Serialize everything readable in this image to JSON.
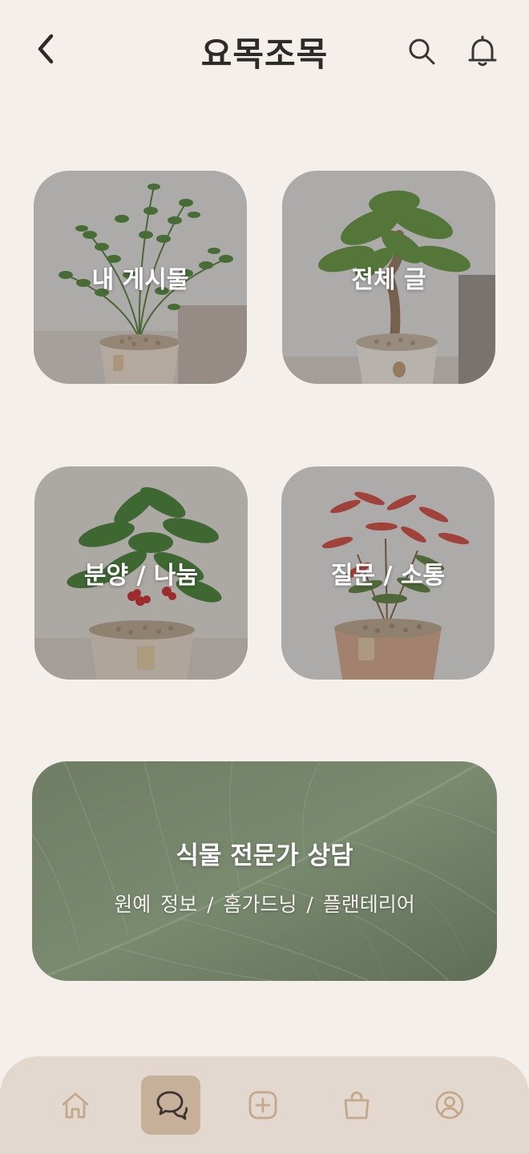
{
  "header": {
    "title": "요목조목",
    "back_icon": "chevron-left-icon",
    "search_icon": "search-icon",
    "notification_icon": "bell-icon"
  },
  "categories": [
    {
      "label": "내 게시물"
    },
    {
      "label": "전체 글"
    },
    {
      "label": "분양 / 나눔"
    },
    {
      "label": "질문 / 소통"
    }
  ],
  "consult_banner": {
    "title": "식물 전문가 상담",
    "subtitle": "원예 정보  /  홈가드닝  /  플랜테리어"
  },
  "bottom_nav": {
    "items": [
      {
        "icon": "home-icon",
        "active": false
      },
      {
        "icon": "chat-bubbles-icon",
        "active": true
      },
      {
        "icon": "add-square-icon",
        "active": false
      },
      {
        "icon": "shopping-bag-icon",
        "active": false
      },
      {
        "icon": "profile-icon",
        "active": false
      }
    ],
    "active_color": "#c6b09a",
    "icon_color": "#c4a889"
  },
  "colors": {
    "background": "#f4efeb",
    "title": "#2e2a28",
    "nav_background": "#e3d8d0"
  }
}
